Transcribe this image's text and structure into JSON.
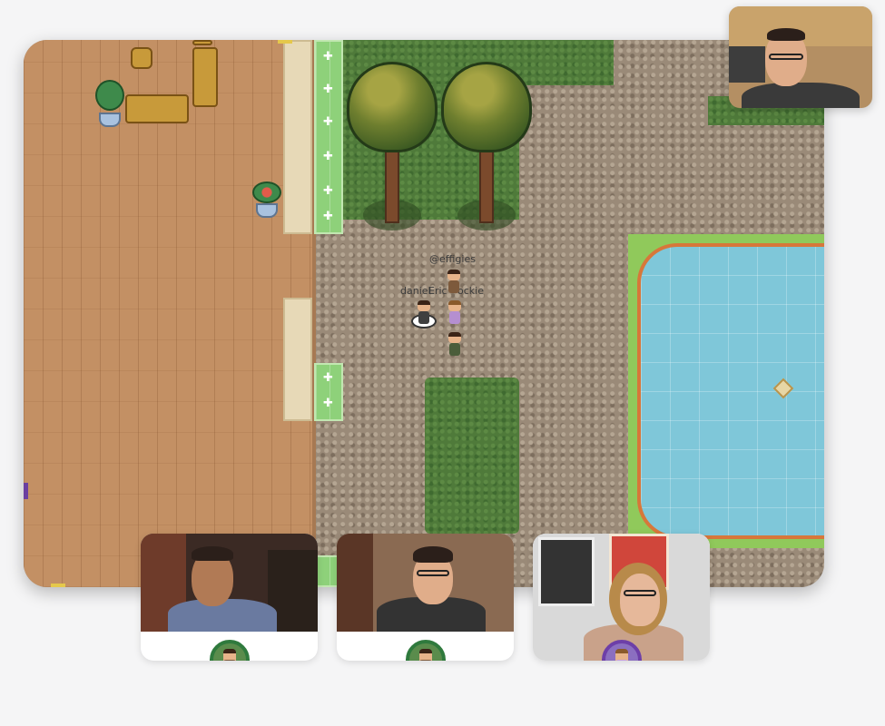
{
  "map": {
    "players": [
      {
        "name": "@effigies"
      },
      {
        "name": "daniel"
      },
      {
        "name": "Eric"
      },
      {
        "name": "ockie"
      }
    ]
  },
  "video_tiles": [
    {
      "avatar": "green-border-avatar"
    },
    {
      "avatar": "green-border-avatar"
    },
    {
      "avatar": "purple-border-avatar"
    }
  ],
  "colors": {
    "background": "#f5f5f6",
    "floor": "#c39064",
    "grass": "#4f7a3a",
    "water": "#7fc7d9",
    "pond_rim": "#d7773a",
    "avatar_ring_green": "#2f7a3d",
    "avatar_ring_purple": "#6d3fa8"
  }
}
